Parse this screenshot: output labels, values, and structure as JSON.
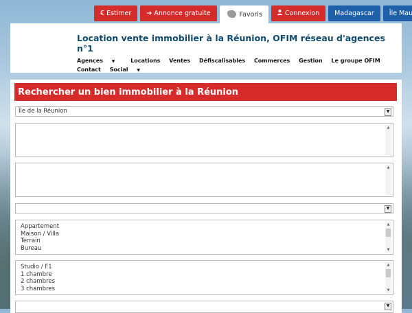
{
  "topbar": {
    "estimer": "€ Estimer",
    "annonce": "➜ Annonce gratuite",
    "favoris": "Favoris",
    "connexion": "Connexion",
    "madagascar": "Madagascar",
    "maurice": "Île Maurice"
  },
  "header": {
    "title": "Location vente immobilier à la Réunion, OFIM réseau d'agences n°1"
  },
  "nav": {
    "items": [
      "Agences",
      "Locations",
      "Ventes",
      "Défiscalisables",
      "Commerces",
      "Gestion",
      "Le groupe OFIM",
      "Contact",
      "Social"
    ]
  },
  "search": {
    "title": "Rechercher un bien immobilier à la Réunion",
    "region_selected": "Île de la Réunion",
    "types": [
      "Appartement",
      "Maison / Villa",
      "Terrain",
      "Bureau"
    ],
    "rooms": [
      "Studio / F1",
      "1 chambre",
      "2 chambres",
      "3 chambres"
    ]
  },
  "colors": {
    "accent_red": "#d62b2b",
    "accent_blue": "#1d5fa8",
    "title_blue": "#0e4a6e"
  }
}
